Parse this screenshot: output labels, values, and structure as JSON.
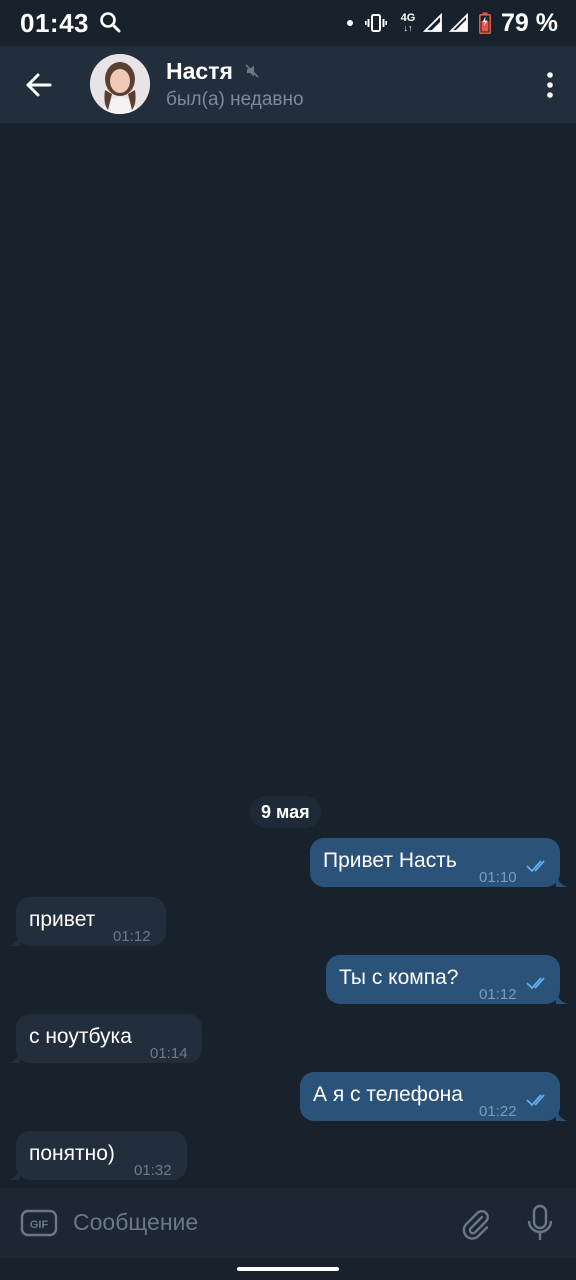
{
  "status_bar": {
    "time": "01:43",
    "battery_percent": "79 %",
    "network": "4G",
    "icons": [
      "search-icon",
      "vibrate-icon",
      "signal-icon",
      "signal-icon",
      "battery-icon"
    ]
  },
  "header": {
    "contact_name": "Настя",
    "status": "был(а) недавно",
    "icons": [
      "back-arrow-icon",
      "muted-icon",
      "more-vertical-icon"
    ]
  },
  "chat": {
    "date_separator": "9 мая",
    "messages": [
      {
        "direction": "out",
        "text": "Привет Насть",
        "time": "01:10",
        "read": true
      },
      {
        "direction": "in",
        "text": "привет",
        "time": "01:12"
      },
      {
        "direction": "out",
        "text": "Ты с компа?",
        "time": "01:12",
        "read": true
      },
      {
        "direction": "in",
        "text": "с ноутбука",
        "time": "01:14"
      },
      {
        "direction": "out",
        "text": "А я с телефона",
        "time": "01:22",
        "read": true
      },
      {
        "direction": "in",
        "text": "понятно)",
        "time": "01:32"
      }
    ]
  },
  "composer": {
    "placeholder": "Сообщение",
    "gif_label": "GIF",
    "icons": [
      "gif-icon",
      "attach-icon",
      "microphone-icon"
    ]
  },
  "colors": {
    "background": "#18222d",
    "header": "#232e3c",
    "outgoing_bubble": "#2b5278",
    "incoming_bubble": "#232e3c",
    "read_ticks": "#5fb0f0"
  }
}
